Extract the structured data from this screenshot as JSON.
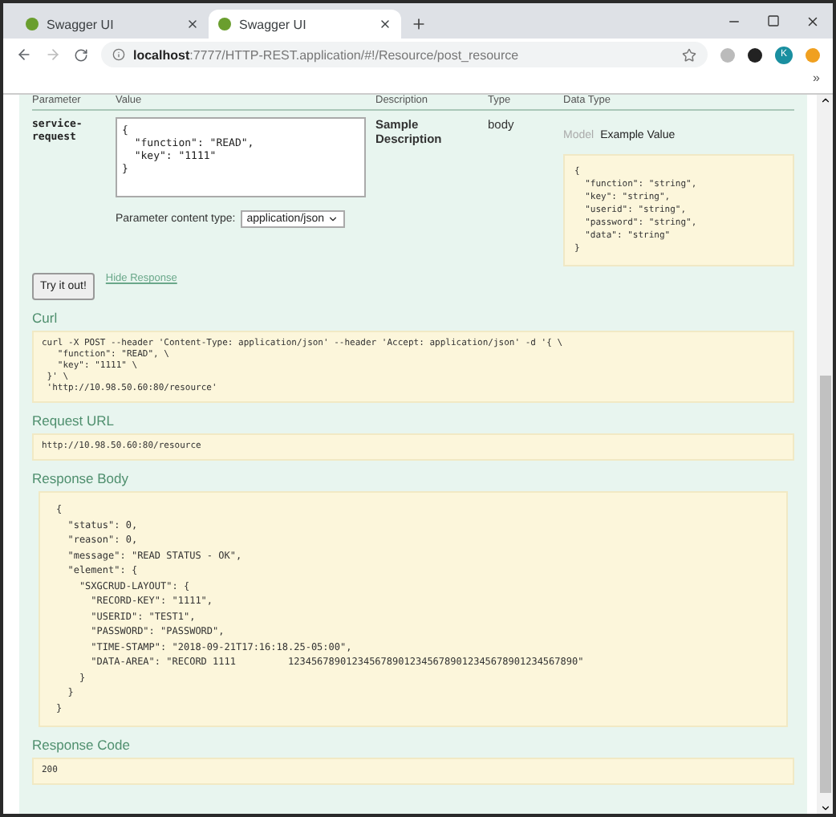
{
  "browser_tabs": [
    {
      "title": "Swagger UI",
      "selected": false
    },
    {
      "title": "Swagger UI",
      "selected": true
    }
  ],
  "address_bar": {
    "url": "**localhost**:7777/HTTP-REST.application/#!/Resource/post_resource"
  },
  "profile": {
    "initial": "K"
  },
  "bookmarks_more": "»",
  "parameters_table": {
    "columns": [
      "Parameter",
      "Value",
      "Description",
      "Type",
      "Data Type"
    ],
    "row": {
      "parameter": "service-\nrequest",
      "value": "{\n  \"function\": \"READ\",\n  \"key\": \"1111\"\n}",
      "description": "Sample Description",
      "type": "body",
      "model_tabs": [
        {
          "label": "Model",
          "selected": false
        },
        {
          "label": "Example Value",
          "selected": true
        }
      ],
      "example_value": "{\n  \"function\": \"string\",\n  \"key\": \"string\",\n  \"userid\": \"string\",\n  \"password\": \"string\",\n  \"data\": \"string\"\n}"
    },
    "content_type_label": "Parameter content type:",
    "content_type": "application/json"
  },
  "try_button": "Try it out!",
  "hide_response": "Hide Response",
  "sections": [
    {
      "heading": "Curl",
      "code": "curl -X POST --header 'Content-Type: application/json' --header 'Accept: application/json' -d '{ \\\n   \"function\": \"READ\", \\\n   \"key\": \"1111\" \\\n }' \\\n 'http://10.98.50.60:80/resource'",
      "kind": "plain"
    },
    {
      "heading": "Request URL",
      "code": "http://10.98.50.60:80/resource",
      "kind": "plain"
    },
    {
      "heading": "Response Body",
      "code": "{\n  \"status\": 0,\n  \"reason\": 0,\n  \"message\": \"READ STATUS - OK\",\n  \"element\": {\n    \"SXGCRUD-LAYOUT\": {\n      \"RECORD-KEY\": \"1111\",\n      \"USERID\": \"TEST1\",\n      \"PASSWORD\": \"PASSWORD\",\n      \"TIME-STAMP\": \"2018-09-21T17:16:18.25-05:00\",\n      \"DATA-AREA\": \"RECORD 1111         12345678901234567890123456789012345678901234567890\"\n    }\n  }\n}",
      "kind": "framed"
    },
    {
      "heading": "Response Code",
      "code": "200",
      "kind": "plain"
    }
  ]
}
